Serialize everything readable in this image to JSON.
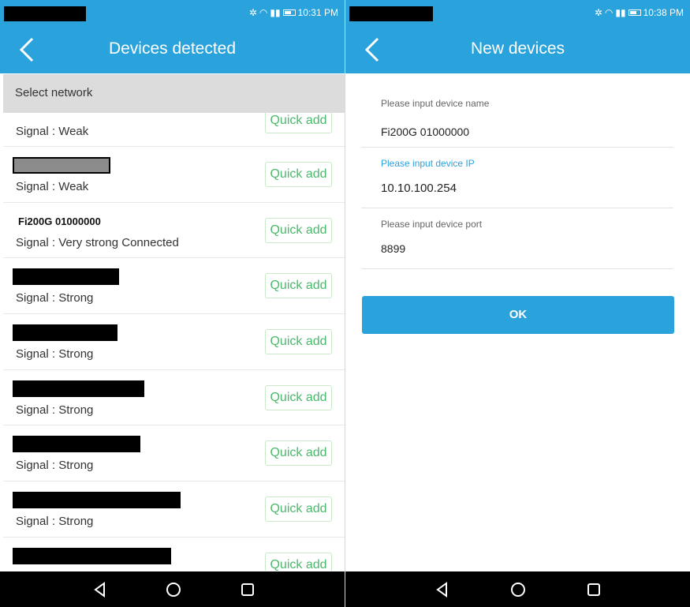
{
  "left_screen": {
    "status_time": "10:31 PM",
    "title": "Devices detected",
    "select_network_label": "Select network",
    "quick_add_label": "Quick add",
    "devices": [
      {
        "name": "",
        "signal": "Signal : Weak"
      },
      {
        "name": "",
        "signal": "Signal : Weak"
      },
      {
        "name": "Fi200G 01000000",
        "signal": "Signal : Very strong  Connected"
      },
      {
        "name": "",
        "signal": "Signal : Strong"
      },
      {
        "name": "",
        "signal": "Signal : Strong"
      },
      {
        "name": "",
        "signal": "Signal : Strong"
      },
      {
        "name": "",
        "signal": "Signal : Strong"
      },
      {
        "name": "",
        "signal": "Signal : Strong"
      },
      {
        "name": "",
        "signal": ""
      }
    ]
  },
  "right_screen": {
    "status_time": "10:38 PM",
    "title": "New devices",
    "fields": [
      {
        "label": "Please input device name",
        "value": "Fi200G 01000000"
      },
      {
        "label": "Please input device IP",
        "value": "10.10.100.254"
      },
      {
        "label": "Please input device port",
        "value": "8899"
      }
    ],
    "ok_label": "OK"
  },
  "icons": {
    "back": "chevron-left-icon",
    "nav_back": "triangle-back-icon",
    "nav_home": "circle-home-icon",
    "nav_recent": "square-recent-icon"
  },
  "colors": {
    "accent": "#2aa2db",
    "quick_add_text": "#49b96b"
  }
}
